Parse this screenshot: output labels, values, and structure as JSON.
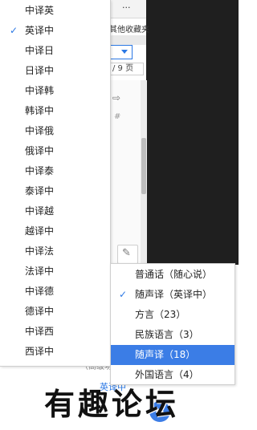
{
  "toolbar": {
    "more_label": "···",
    "other_favorites_label": "其他收藏夹",
    "page_counter": "/ 9 页"
  },
  "doc": {
    "arrow_glyph": "⇨",
    "hash_glyph": "#",
    "edit_glyph": "✎"
  },
  "languages": {
    "items": [
      {
        "label": "中译英",
        "checked": false
      },
      {
        "label": "英译中",
        "checked": true
      },
      {
        "label": "中译日",
        "checked": false
      },
      {
        "label": "日译中",
        "checked": false
      },
      {
        "label": "中译韩",
        "checked": false
      },
      {
        "label": "韩译中",
        "checked": false
      },
      {
        "label": "中译俄",
        "checked": false
      },
      {
        "label": "俄译中",
        "checked": false
      },
      {
        "label": "中译泰",
        "checked": false
      },
      {
        "label": "泰译中",
        "checked": false
      },
      {
        "label": "中译越",
        "checked": false
      },
      {
        "label": "越译中",
        "checked": false
      },
      {
        "label": "中译法",
        "checked": false
      },
      {
        "label": "法译中",
        "checked": false
      },
      {
        "label": "中译德",
        "checked": false
      },
      {
        "label": "德译中",
        "checked": false
      },
      {
        "label": "中译西",
        "checked": false
      },
      {
        "label": "西译中",
        "checked": false
      }
    ]
  },
  "voice_modes": {
    "items": [
      {
        "label": "普通话（随心说）",
        "checked": false,
        "highlighted": false
      },
      {
        "label": "随声译（英译中）",
        "checked": true,
        "highlighted": false
      },
      {
        "label": "方言（23）",
        "checked": false,
        "highlighted": false
      },
      {
        "label": "民族语言（3）",
        "checked": false,
        "highlighted": false
      },
      {
        "label": "随声译（18）",
        "checked": false,
        "highlighted": true
      },
      {
        "label": "外国语言（4）",
        "checked": false,
        "highlighted": false
      }
    ]
  },
  "check_glyph": "✓",
  "accent_color": "#3b7de6",
  "bottom": {
    "blue_link": "英译中",
    "hint": "（高级功能）"
  },
  "watermark": "有趣论坛"
}
